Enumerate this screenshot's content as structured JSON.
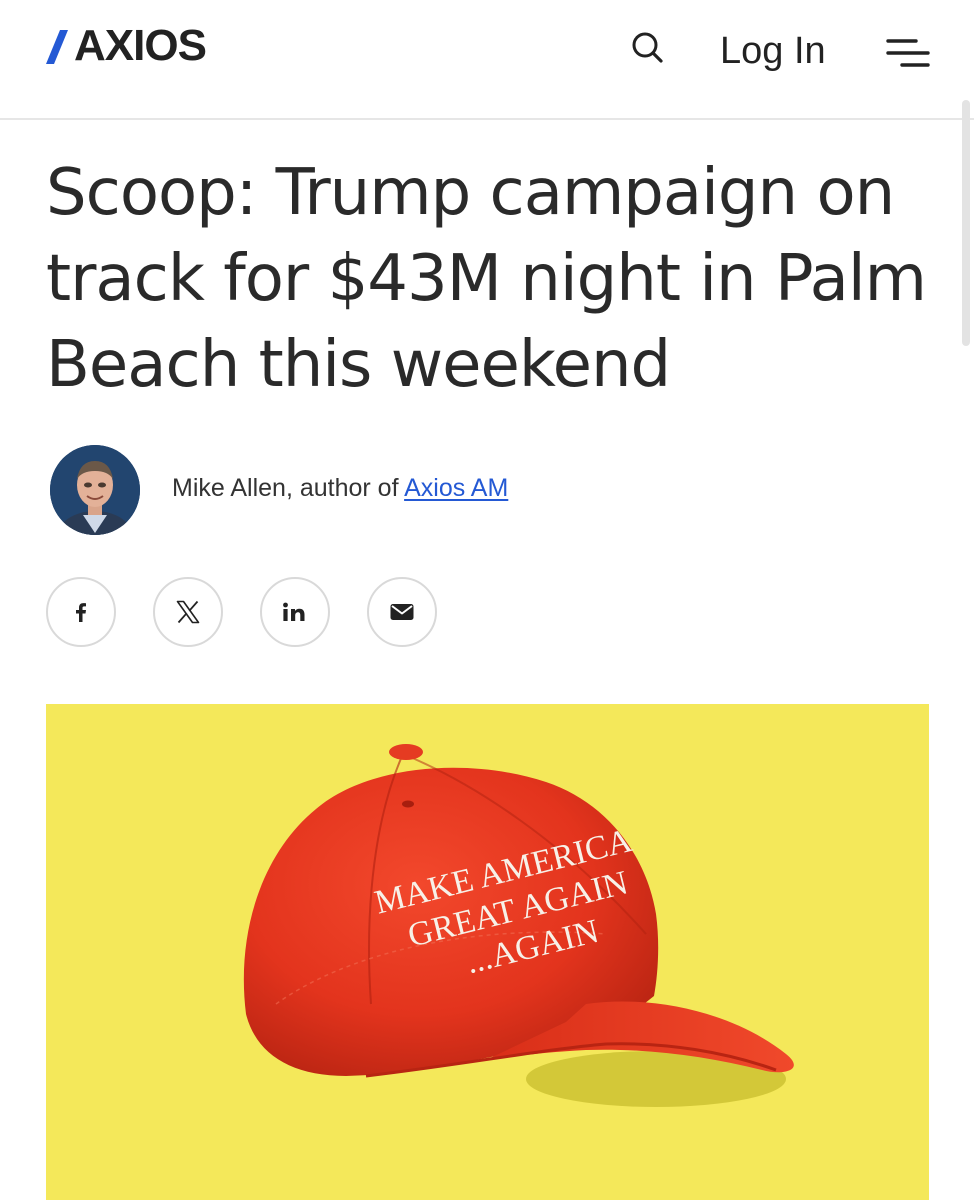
{
  "header": {
    "logo_text": "AXIOS",
    "search_icon": "search-icon",
    "login_label": "Log In",
    "menu_icon": "hamburger-menu-icon"
  },
  "article": {
    "headline": "Scoop: Trump campaign on track for $43M night in Palm Beach this weekend",
    "byline_prefix": "Mike Allen, author of",
    "byline_link": "Axios AM"
  },
  "share": {
    "icons": [
      "facebook-icon",
      "x-icon",
      "linkedin-icon",
      "email-icon"
    ]
  },
  "hero": {
    "cap_text_line1": "MAKE AMERICA",
    "cap_text_line2": "GREAT AGAIN",
    "cap_text_line3": "...AGAIN",
    "background_color": "#f4e85a",
    "cap_color": "#e8351f"
  },
  "colors": {
    "logo_accent": "#2459d4",
    "link": "#2459d4",
    "text": "#222222"
  }
}
